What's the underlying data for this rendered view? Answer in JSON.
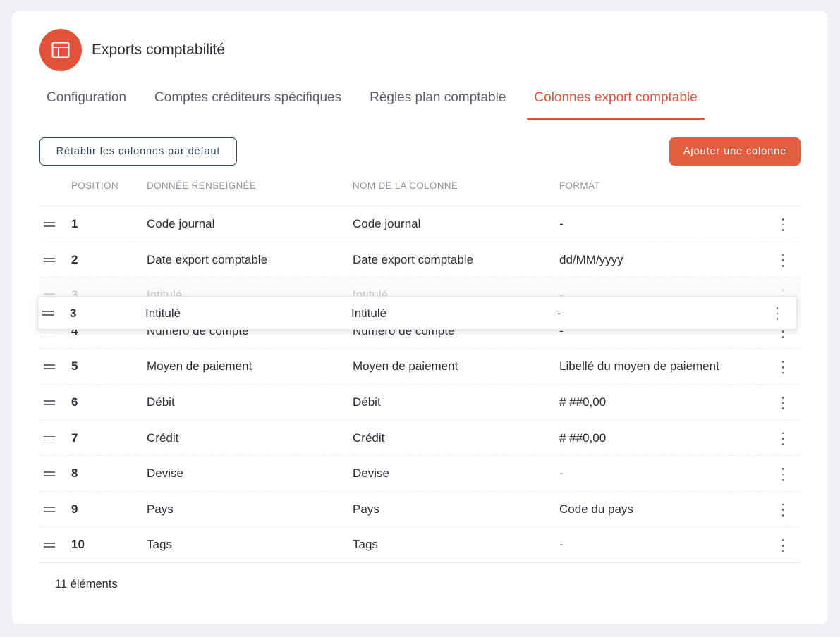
{
  "header": {
    "title": "Exports comptabilité",
    "icon": "layout-icon",
    "accent_color": "#e2513a"
  },
  "tabs": [
    {
      "label": "Configuration",
      "active": false
    },
    {
      "label": "Comptes créditeurs spécifiques",
      "active": false
    },
    {
      "label": "Règles plan comptable",
      "active": false
    },
    {
      "label": "Colonnes export comptable",
      "active": true
    }
  ],
  "toolbar": {
    "reset_label": "Rétablir les colonnes par défaut",
    "add_label": "Ajouter une colonne"
  },
  "table": {
    "columns": [
      "Position",
      "Donnée renseignée",
      "Nom de la colonne",
      "Format"
    ],
    "rows": [
      {
        "position": "1",
        "data": "Code journal",
        "name": "Code journal",
        "format": "-"
      },
      {
        "position": "2",
        "data": "Date export comptable",
        "name": "Date export comptable",
        "format": "dd/MM/yyyy"
      },
      {
        "position": "3",
        "data": "Intitulé",
        "name": "Intitulé",
        "format": "-"
      },
      {
        "position": "4",
        "data": "Numéro de compte",
        "name": "Numéro de compte",
        "format": "-"
      },
      {
        "position": "5",
        "data": "Moyen de paiement",
        "name": "Moyen de paiement",
        "format": "Libellé du moyen de paiement"
      },
      {
        "position": "6",
        "data": "Débit",
        "name": "Débit",
        "format": "# ##0,00"
      },
      {
        "position": "7",
        "data": "Crédit",
        "name": "Crédit",
        "format": "# ##0,00"
      },
      {
        "position": "8",
        "data": "Devise",
        "name": "Devise",
        "format": "-"
      },
      {
        "position": "9",
        "data": "Pays",
        "name": "Pays",
        "format": "Code du pays"
      },
      {
        "position": "10",
        "data": "Tags",
        "name": "Tags",
        "format": "-"
      }
    ],
    "dragging": {
      "position": "3",
      "data": "Intitulé",
      "name": "Intitulé",
      "format": "-"
    }
  },
  "footer": {
    "count_label": "11 éléments"
  }
}
